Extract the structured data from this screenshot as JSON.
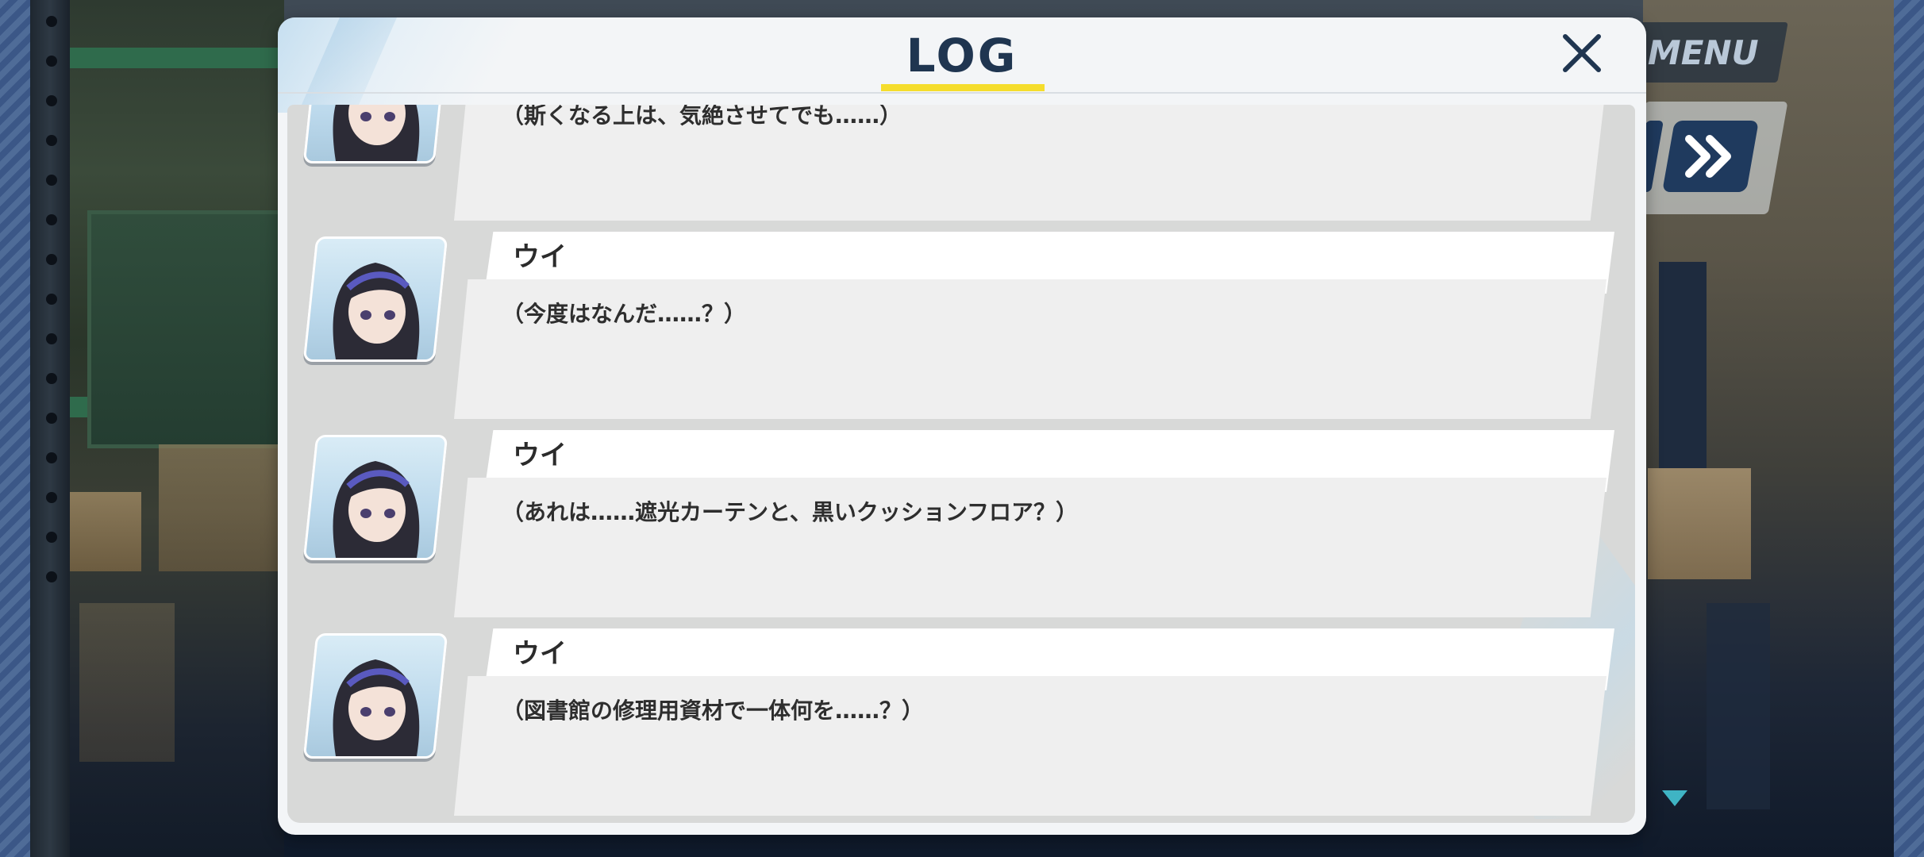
{
  "hud": {
    "menu_label": "MENU"
  },
  "log": {
    "title": "LOG",
    "entries": [
      {
        "speaker": "",
        "message": "（斯くなる上は、気絶させてでも……）",
        "avatar": "ui-portrait"
      },
      {
        "speaker": "ウイ",
        "message": "（今度はなんだ……？）",
        "avatar": "ui-portrait"
      },
      {
        "speaker": "ウイ",
        "message": "（あれは……遮光カーテンと、黒いクッションフロア？）",
        "avatar": "ui-portrait"
      },
      {
        "speaker": "ウイ",
        "message": "（図書館の修理用資材で一体何を……？）",
        "avatar": "ui-portrait"
      }
    ]
  },
  "icons": {
    "close": "close-icon",
    "fast_forward": "fast-forward-icon",
    "next_indicator": "triangle-down-icon"
  },
  "colors": {
    "title": "#1f3550",
    "title_underline": "#f5dd2d",
    "button_dark": "#1f3a5e",
    "indicator": "#3fb4c4"
  }
}
